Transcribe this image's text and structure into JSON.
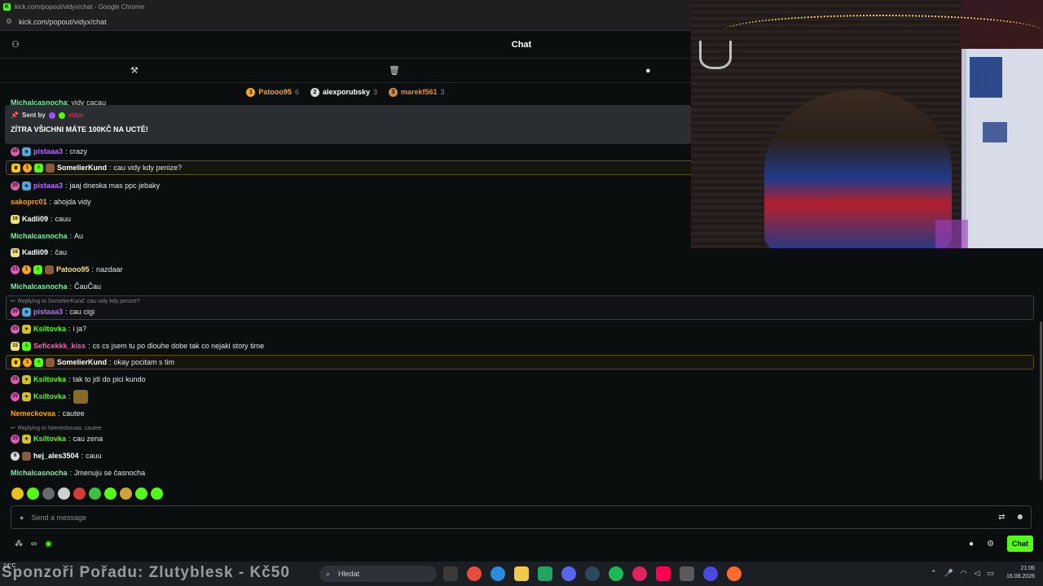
{
  "browser": {
    "window_title": "kick.com/popout/vidyx/chat - Google Chrome",
    "url": "kick.com/popout/vidyx/chat",
    "favicon": "K"
  },
  "header": {
    "title": "Chat"
  },
  "leaderboard": [
    {
      "rank": "1",
      "name": "Patooo95",
      "count": "6",
      "color": "#f5a623",
      "name_color": "#f5a623"
    },
    {
      "rank": "2",
      "name": "alexporubsky",
      "count": "3",
      "color": "#d9d9d9",
      "name_color": "#ffffff"
    },
    {
      "rank": "3",
      "name": "marekf561",
      "count": "3",
      "color": "#cd8a4b",
      "name_color": "#e28e4f"
    }
  ],
  "cut_message": {
    "user": "Michalcasnocha",
    "text": "vidy cacau"
  },
  "pinned": {
    "sent_by_label": "Sent by",
    "sender": "vidyx",
    "message": "ZÍTRA VŠICHNI MÁTE 100KČ NA UCTĚ!"
  },
  "messages": [
    {
      "user": "pistaaa3",
      "sep": ":",
      "text": "crazy",
      "color": "#b86bff"
    },
    {
      "user": "SomelierKund",
      "sep": ":",
      "text": "cau vidy kdy penize?",
      "color": "#ffffff"
    },
    {
      "user": "pistaaa3",
      "sep": ":",
      "text": "jaaj dneska mas ppc jebaky",
      "color": "#b86bff"
    },
    {
      "user": "sakoprc01",
      "sep": ":",
      "text": "ahojda vidy",
      "color": "#f5a623"
    },
    {
      "user": "Kadli09",
      "sep": ":",
      "text": "cauu",
      "color": "#ffffff",
      "badge": "16"
    },
    {
      "user": "Michalcasnocha",
      "sep": ":",
      "text": "Au",
      "color": "#7cf0a5"
    },
    {
      "user": "Kadli09",
      "sep": ":",
      "text": "čau",
      "color": "#ffffff",
      "badge": "16"
    },
    {
      "user": "Patooo95",
      "sep": ":",
      "text": "nazdaar",
      "color": "#f2e27a",
      "badge": "21"
    },
    {
      "user": "Michalcasnocha",
      "sep": ":",
      "text": "ČauČau",
      "color": "#7cf0a5"
    },
    {
      "user": "pistaaa3",
      "sep": ":",
      "text": "cau cigi",
      "color": "#b86bff",
      "reply": "Replying to SomelierKund: cau vidy kdy penize?"
    },
    {
      "user": "Ksiltovka",
      "sep": ":",
      "text": "i ja?",
      "color": "#53fc18"
    },
    {
      "user": "Seficekkk_kiss",
      "sep": ":",
      "text": "cs cs jsem tu po dlouhe dobe tak co nejaki story time",
      "color": "#ff5cb8",
      "badge": "15"
    },
    {
      "user": "SomelierKund",
      "sep": ":",
      "text": "okay pocitam s tim",
      "color": "#ffffff"
    },
    {
      "user": "Ksiltovka",
      "sep": ":",
      "text": "tak to jdi do pici kundo",
      "color": "#53fc18"
    },
    {
      "user": "Ksiltovka",
      "sep": ":",
      "text": "",
      "color": "#53fc18"
    },
    {
      "user": "Nemeckovaa",
      "sep": ":",
      "text": "cautee",
      "color": "#f5a623"
    },
    {
      "user": "Ksiltovka",
      "sep": ":",
      "text": "cau zena",
      "color": "#53fc18",
      "reply": "Replying to Nemeckovaa: cautee"
    },
    {
      "user": "hej_ales3504",
      "sep": ":",
      "text": "cauu",
      "color": "#ffffff",
      "badge": "8"
    },
    {
      "user": "Michalcasnocha",
      "sep": ":",
      "text": "Jmenuju se časnocha",
      "color": "#7cf0a5"
    }
  ],
  "emotes": [
    "#e9c31c",
    "#53fc18",
    "#666a6f",
    "#d0d0d0",
    "#d63a3a",
    "#3fbf3f",
    "#53fc18",
    "#d2a23a",
    "#53fc18",
    "#53fc18"
  ],
  "input": {
    "placeholder": "Send a message"
  },
  "bottom": {
    "chat_button": "Chat"
  },
  "taskbar": {
    "temperature": "24°C",
    "overlay_text": "Sponzoři Pořadu: Zlutyblesk - Kč50",
    "search_placeholder": "Hledat",
    "time": "21:06",
    "date": "16.08.2026",
    "apps": [
      "#3a3a3a",
      "#e74c3c",
      "#2a8bdc",
      "#f2c94c",
      "#1fa463",
      "#5865f2",
      "#2a475e",
      "#1db954",
      "#e0245e",
      "#ff0050",
      "#5a5a5a",
      "#4a4ae0",
      "#ff6b2d"
    ]
  },
  "colors": {
    "accent": "#53fc18"
  }
}
